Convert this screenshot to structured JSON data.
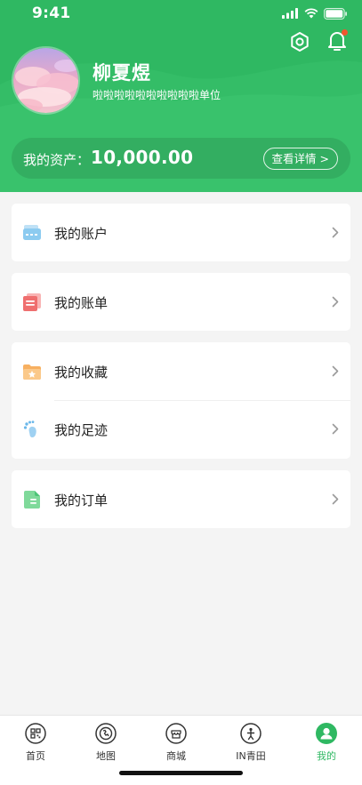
{
  "status_bar": {
    "time": "9:41"
  },
  "profile": {
    "name": "柳夏煜",
    "description": "啦啦啦啦啦啦啦啦啦啦单位",
    "avatar_icon": "avatar-pink-clouds"
  },
  "header": {
    "settings_icon": "gear-icon",
    "bell_icon": "bell-icon",
    "has_notification": true
  },
  "assets": {
    "label": "我的资产：",
    "value": "10,000.00",
    "detail_button": "查看详情 >"
  },
  "menu": {
    "account": {
      "label": "我的账户",
      "icon": "wallet-icon"
    },
    "bill": {
      "label": "我的账单",
      "icon": "bill-icon"
    },
    "favorites": {
      "label": "我的收藏",
      "icon": "folder-star-icon"
    },
    "footprint": {
      "label": "我的足迹",
      "icon": "footprint-icon"
    },
    "orders": {
      "label": "我的订单",
      "icon": "order-icon"
    }
  },
  "tabbar": {
    "tabs": [
      {
        "label": "首页",
        "icon": "qrcode-icon",
        "active": false
      },
      {
        "label": "地图",
        "icon": "globe-icon",
        "active": false
      },
      {
        "label": "商城",
        "icon": "shop-icon",
        "active": false
      },
      {
        "label": "IN青田",
        "icon": "figure-icon",
        "active": false
      },
      {
        "label": "我的",
        "icon": "user-icon",
        "active": true
      }
    ]
  },
  "colors": {
    "brand_green": "#2fb862",
    "notification_dot": "#f0552f",
    "background": "#f4f4f4"
  }
}
